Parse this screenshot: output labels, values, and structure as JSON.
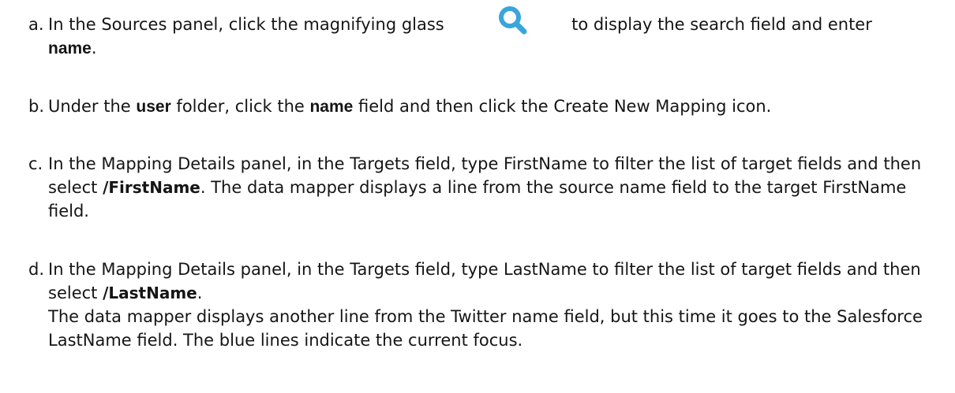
{
  "steps": [
    {
      "marker": "a.",
      "t1": "In the ",
      "b1": "Sources",
      "t2": " panel, click the magnifying glass ",
      "icon": "search-icon",
      "t3": " to display the search field and enter",
      "b2": "name",
      "t4": "."
    },
    {
      "marker": "b.",
      "t1": "Under the ",
      "b1": "user",
      "t2": " folder, click the ",
      "b2": "name",
      "t3": " field and then click the ",
      "b3": "Create New Mapping",
      "t4": " icon."
    },
    {
      "marker": "c.",
      "t1": "In the ",
      "b1": "Mapping Details",
      "t2": " panel, in the ",
      "b2": "Targets",
      "t3": " field, type ",
      "b3": "FirstName",
      "t4": " to filter the list of target fields and then select ",
      "b4": "/FirstName",
      "t5": ". The data mapper displays a line from the source ",
      "b5": "name",
      "t6": " field to the target ",
      "b6": "FirstName",
      "t7": " field."
    },
    {
      "marker": "d.",
      "t1": "In the ",
      "b1": "Mapping Details",
      "t2": " panel, in the ",
      "b2": "Targets",
      "t3": " field, type ",
      "b3": "LastName",
      "t4": " to filter the list of target fields and then select ",
      "b4": "/LastName",
      "t5": ".",
      "t6": "The data mapper displays another line from the Twitter ",
      "b5": "name",
      "t7": " field, but this time it goes to the Salesforce ",
      "b6": "LastName",
      "t8": " field. The blue lines indicate the current focus."
    }
  ],
  "colors": {
    "text": "#151515",
    "icon": "#39a5dc"
  }
}
